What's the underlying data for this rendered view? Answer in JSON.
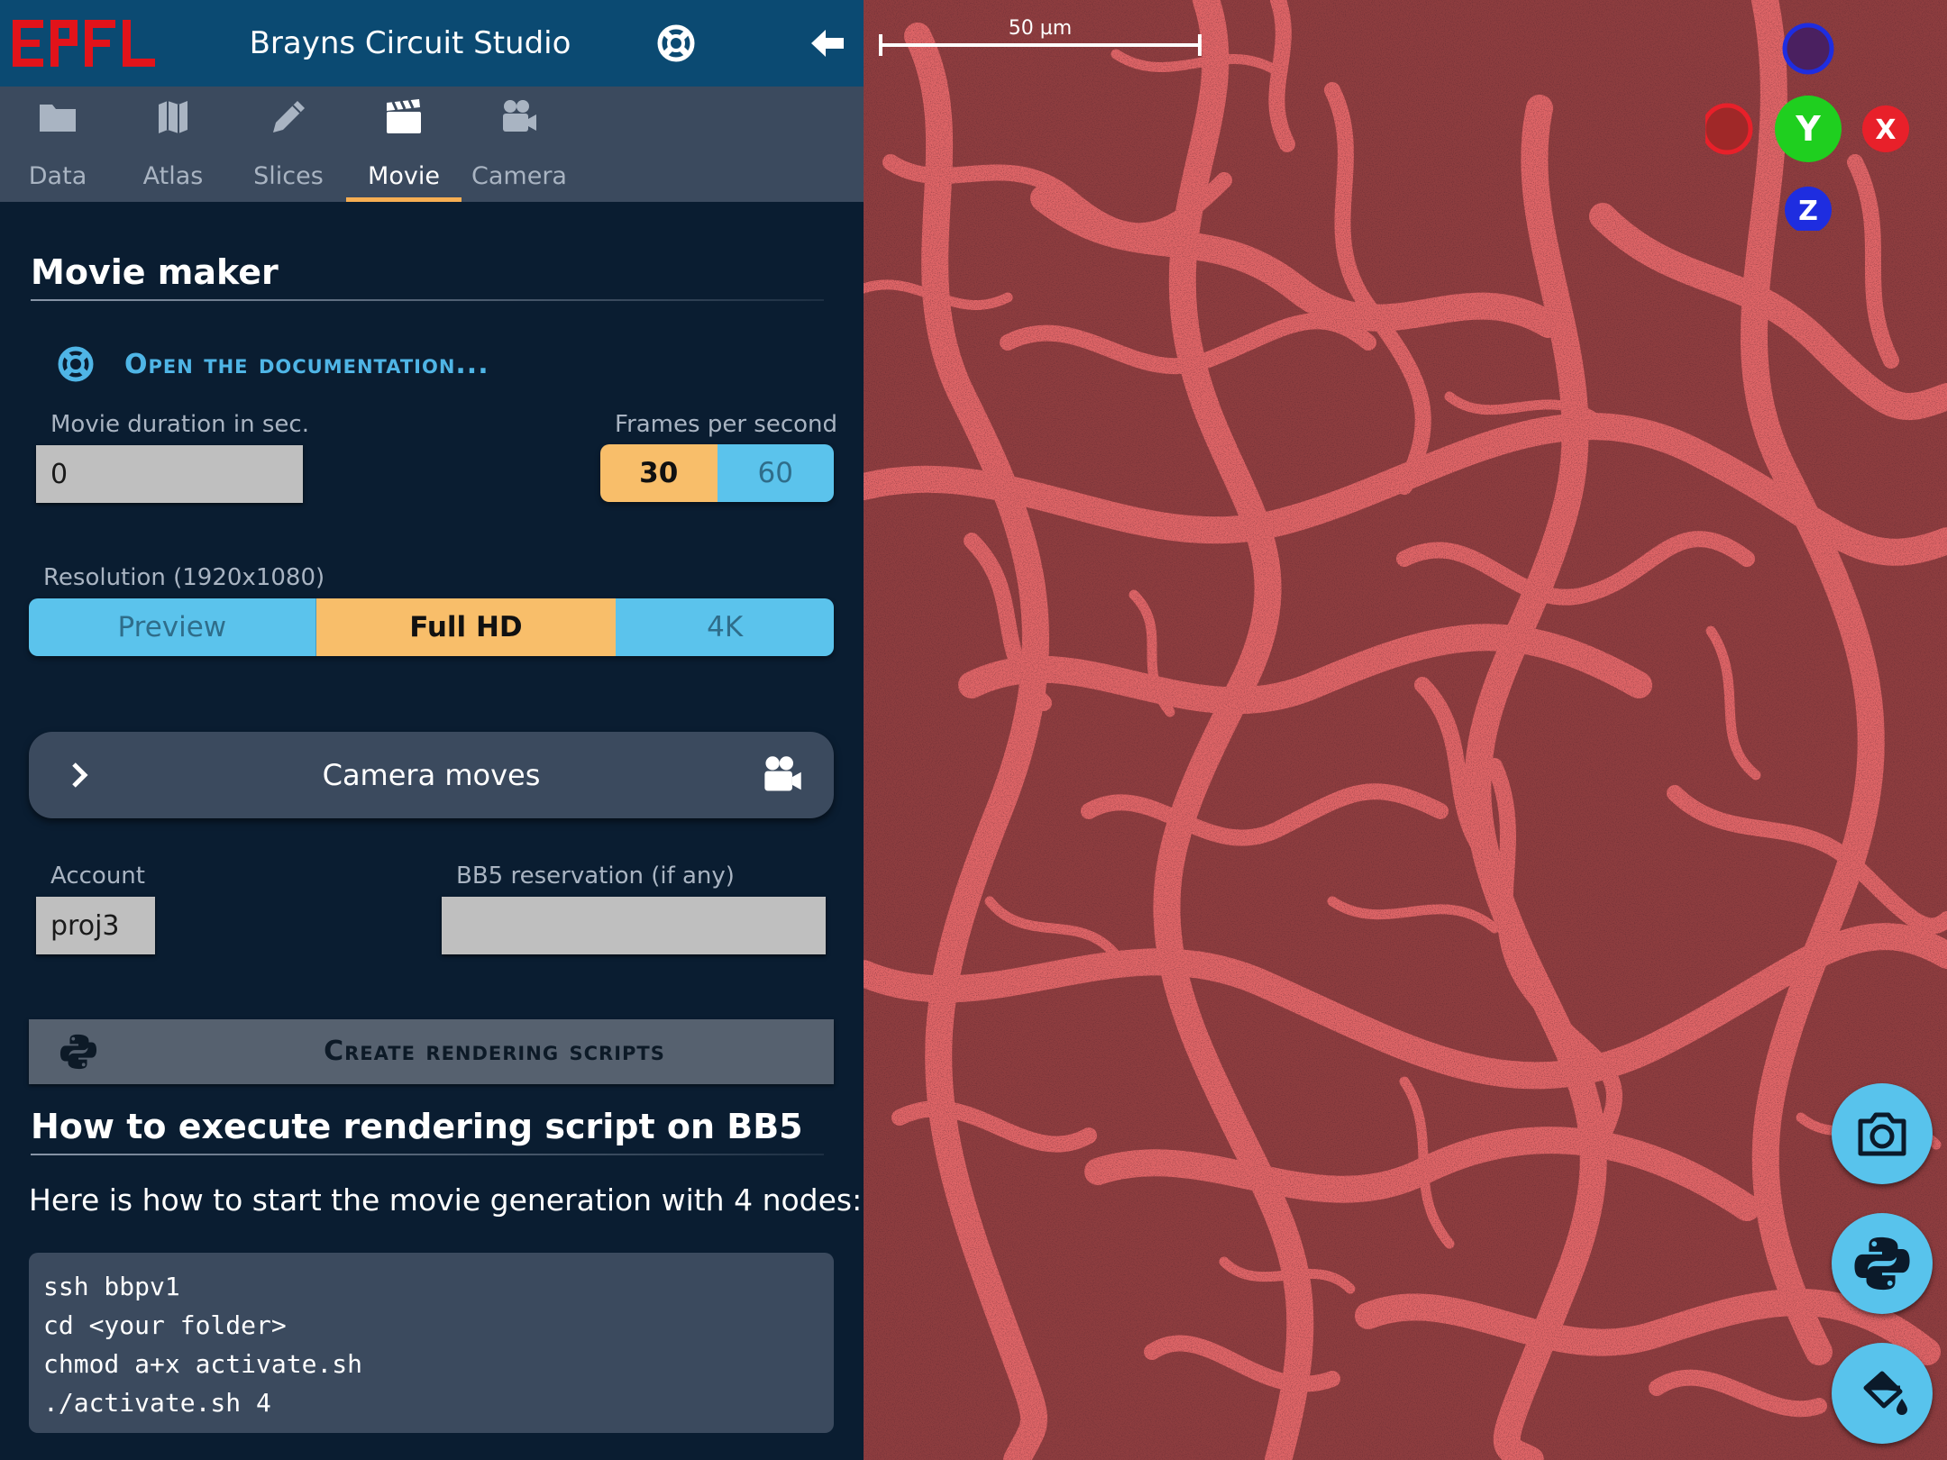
{
  "app": {
    "title": "Brayns Circuit Studio",
    "logo_text": "EPFL",
    "back_icon": "arrow-left-icon",
    "help_icon": "lifebuoy-icon"
  },
  "tabs": [
    {
      "label": "Data",
      "icon": "folder-icon"
    },
    {
      "label": "Atlas",
      "icon": "map-icon"
    },
    {
      "label": "Slices",
      "icon": "pencil-icon"
    },
    {
      "label": "Movie",
      "icon": "clapperboard-icon",
      "active": true
    },
    {
      "label": "Camera",
      "icon": "video-camera-icon"
    }
  ],
  "movie": {
    "title": "Movie maker",
    "doc_link": "Open the documentation...",
    "duration_label": "Movie duration in sec.",
    "duration_value": "0",
    "fps_label": "Frames per second",
    "fps_options": [
      "30",
      "60"
    ],
    "fps_selected": "30",
    "resolution_label": "Resolution (1920x1080)",
    "resolution_options": [
      "Preview",
      "Full HD",
      "4K"
    ],
    "resolution_selected": "Full HD",
    "camera_moves_label": "Camera moves",
    "account_label": "Account",
    "account_value": "proj3",
    "reservation_label": "BB5 reservation (if any)",
    "reservation_value": "",
    "create_button": "Create rendering scripts"
  },
  "howto": {
    "title": "How to execute rendering script on BB5",
    "description": "Here is how to start the movie generation with 4 nodes:",
    "code": [
      "ssh bbpv1",
      "cd <your folder>",
      "chmod a+x activate.sh",
      "./activate.sh 4"
    ]
  },
  "viewport": {
    "scale_bar_label": "50 µm",
    "axis_labels": {
      "x": "X",
      "y": "Y",
      "z": "Z"
    },
    "axis_colors": {
      "x": "#e8202a",
      "y": "#1fcf1f",
      "z": "#1e2de0"
    },
    "buttons": [
      "camera-icon",
      "python-icon",
      "paint-bucket-icon"
    ]
  },
  "colors": {
    "accent": "#f8be6a",
    "option": "#5bc3ec",
    "link": "#4fb5e6",
    "header": "#0b4a72",
    "panel": "#0a1d31",
    "neurons": "#e06567"
  }
}
